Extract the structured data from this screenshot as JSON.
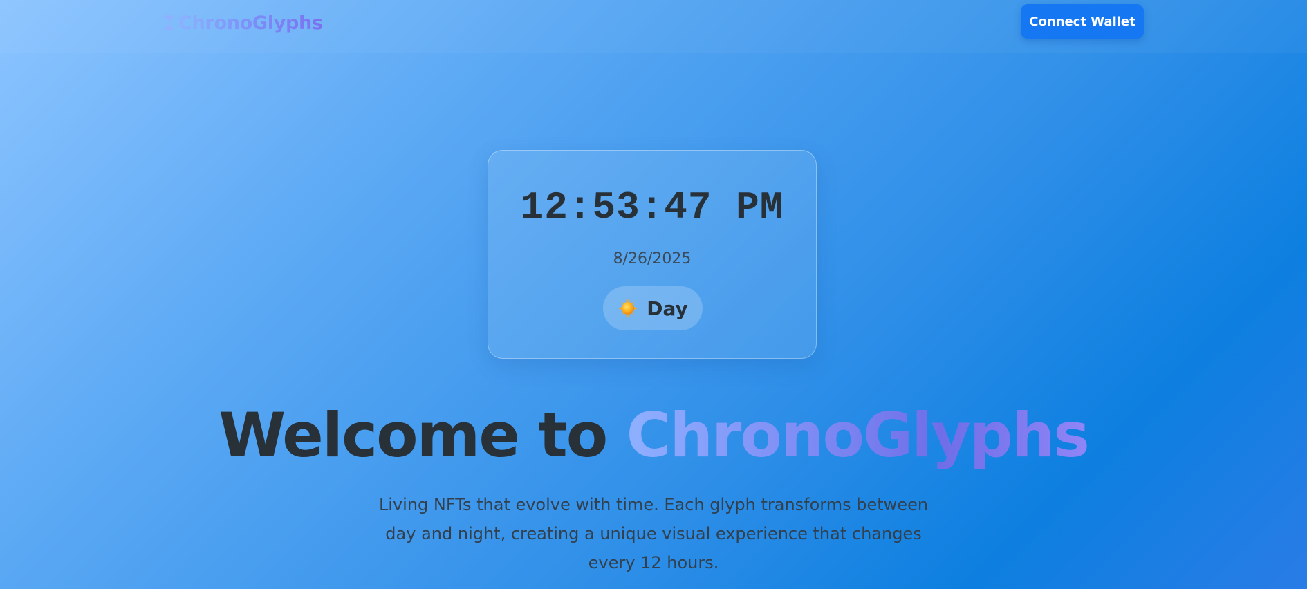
{
  "header": {
    "brand_name": "ChronoGlyphs",
    "brand_icon": "hourglass-icon",
    "connect_label": "Connect Wallet"
  },
  "clock": {
    "time": "12:53:47 PM",
    "date": "8/26/2025",
    "mode_icon": "sun-icon",
    "mode_label": "Day"
  },
  "hero": {
    "title_lead": "Welcome to ",
    "title_accent": "ChronoGlyphs",
    "subtitle": "Living NFTs that evolve with time. Each glyph transforms between day and night, creating a unique visual experience that changes every 12 hours."
  },
  "colors": {
    "accent_button": "#1577f2",
    "gradient_start": "#8fb0ff",
    "gradient_end": "#6f6ee8",
    "text_dark": "#283038"
  }
}
